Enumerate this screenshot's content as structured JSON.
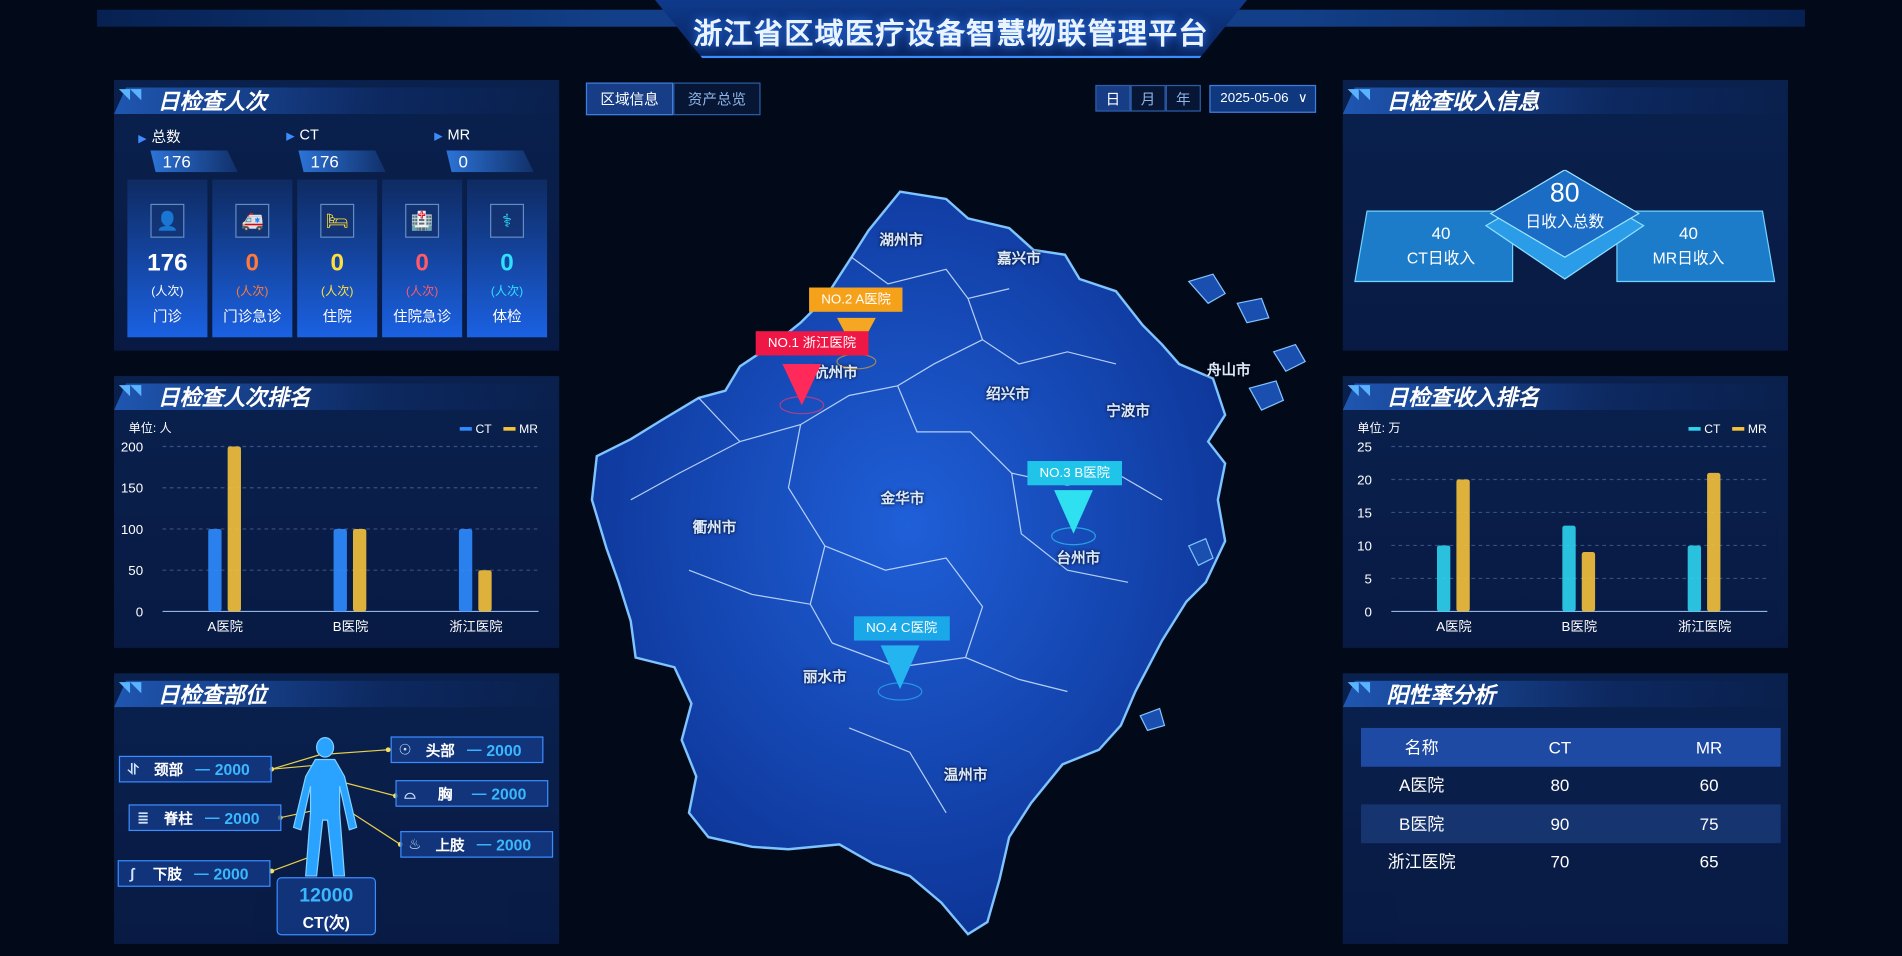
{
  "header": {
    "title": "浙江省区域医疗设备智慧物联管理平台"
  },
  "panels": {
    "daily_checks": "日检查人次",
    "daily_checks_rank": "日检查人次排名",
    "daily_parts": "日检查部位",
    "daily_income": "日检查收入信息",
    "daily_income_rank": "日检查收入排名",
    "positive_rate": "阳性率分析"
  },
  "stats": {
    "total_label": "总数",
    "total_value": "176",
    "ct_label": "CT",
    "ct_value": "176",
    "mr_label": "MR",
    "mr_value": "0"
  },
  "categories": [
    {
      "value": "176",
      "unit": "(人次)",
      "label": "门诊",
      "color": "#ffffff",
      "unit_color": "#ffffff"
    },
    {
      "value": "0",
      "unit": "(人次)",
      "label": "门诊急诊",
      "color": "#ff7a3a",
      "unit_color": "#ff7a3a"
    },
    {
      "value": "0",
      "unit": "(人次)",
      "label": "住院",
      "color": "#ffe03a",
      "unit_color": "#ffe03a"
    },
    {
      "value": "0",
      "unit": "(人次)",
      "label": "住院急诊",
      "color": "#ff5a6a",
      "unit_color": "#ff5a6a"
    },
    {
      "value": "0",
      "unit": "(人次)",
      "label": "体检",
      "color": "#2fe0ff",
      "unit_color": "#2fe0ff"
    }
  ],
  "map_tabs": {
    "region": "区域信息",
    "assets": "资产总览"
  },
  "date_tabs": {
    "day": "日",
    "month": "月",
    "year": "年",
    "date": "2025-05-06",
    "chevron": "∨"
  },
  "cities": [
    "湖州市",
    "嘉兴市",
    "杭州市",
    "绍兴市",
    "宁波市",
    "舟山市",
    "衢州市",
    "金华市",
    "台州市",
    "丽水市",
    "温州市"
  ],
  "hospitals": {
    "no1": "NO.1 浙江医院",
    "no2": "NO.2 A医院",
    "no3": "NO.3 B医院",
    "no4": "NO.4 C医院"
  },
  "income": {
    "total": "80",
    "total_label": "日收入总数",
    "ct": "40",
    "ct_label": "CT日收入",
    "mr": "40",
    "mr_label": "MR日收入"
  },
  "body_parts": {
    "neck": {
      "name": "颈部",
      "value": "2000"
    },
    "spine": {
      "name": "脊柱",
      "value": "2000"
    },
    "lower": {
      "name": "下肢",
      "value": "2000"
    },
    "head": {
      "name": "头部",
      "value": "2000"
    },
    "chest": {
      "name": "胸",
      "value": "2000"
    },
    "upper": {
      "name": "上肢",
      "value": "2000"
    },
    "total": "12000",
    "total_label": "CT(次)"
  },
  "positive_table": {
    "headers": [
      "名称",
      "CT",
      "MR"
    ],
    "rows": [
      [
        "A医院",
        "80",
        "60"
      ],
      [
        "B医院",
        "90",
        "75"
      ],
      [
        "浙江医院",
        "70",
        "65"
      ]
    ]
  },
  "chart_data": [
    {
      "type": "bar",
      "unit_label": "单位: 人",
      "categories": [
        "A医院",
        "B医院",
        "浙江医院"
      ],
      "series": [
        {
          "name": "CT",
          "values": [
            100,
            100,
            100
          ],
          "color": "#2f8cff"
        },
        {
          "name": "MR",
          "values": [
            200,
            100,
            50
          ],
          "color": "#f5c23a"
        }
      ],
      "yticks": [
        0,
        50,
        100,
        150,
        200
      ],
      "ylim": [
        0,
        200
      ]
    },
    {
      "type": "bar",
      "unit_label": "单位: 万",
      "categories": [
        "A医院",
        "B医院",
        "浙江医院"
      ],
      "series": [
        {
          "name": "CT",
          "values": [
            10,
            13,
            10
          ],
          "color": "#2fd4f0"
        },
        {
          "name": "MR",
          "values": [
            20,
            9,
            21
          ],
          "color": "#f5c23a"
        }
      ],
      "yticks": [
        0,
        5,
        10,
        15,
        20,
        25
      ],
      "ylim": [
        0,
        25
      ]
    }
  ]
}
